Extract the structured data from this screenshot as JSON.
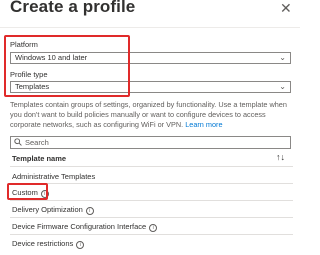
{
  "header": {
    "title": "Create a profile"
  },
  "platform": {
    "label": "Platform",
    "value": "Windows 10 and later"
  },
  "profile_type": {
    "label": "Profile type",
    "value": "Templates"
  },
  "description": {
    "text": "Templates contain groups of settings, organized by functionality. Use a template when you don't want to build policies manually or want to configure devices to access corporate networks, such as configuring WiFi or VPN.",
    "link": "Learn more"
  },
  "search": {
    "placeholder": "Search"
  },
  "table": {
    "header": "Template name",
    "rows": [
      {
        "label": "Administrative Templates"
      },
      {
        "label": "Custom"
      },
      {
        "label": "Delivery Optimization"
      },
      {
        "label": "Device Firmware Configuration Interface"
      },
      {
        "label": "Device restrictions"
      }
    ]
  },
  "colors": {
    "highlight": "#e02a2a",
    "link": "#0078d4"
  }
}
